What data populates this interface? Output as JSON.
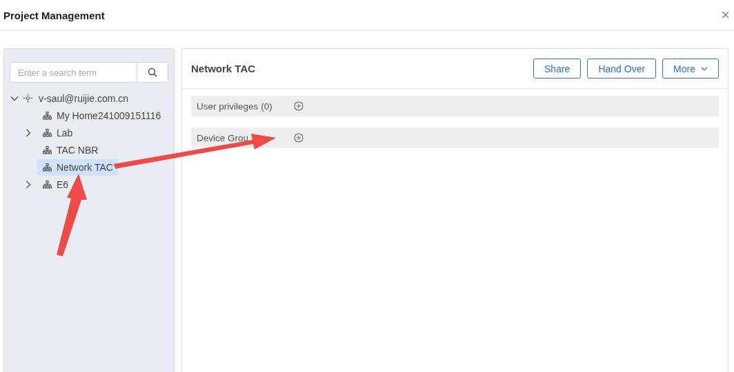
{
  "window": {
    "title": "Project Management",
    "close": "×"
  },
  "search": {
    "placeholder": "Enter a search term"
  },
  "tree": [
    {
      "label": "v-saul@ruijie.com.cn",
      "kind": "account",
      "expanded": true,
      "selected": false,
      "children": [
        {
          "label": "My Home241009151116",
          "kind": "project",
          "selected": false
        },
        {
          "label": "Lab",
          "kind": "project",
          "expanded": false,
          "selected": false
        },
        {
          "label": "TAC NBR",
          "kind": "project",
          "selected": false
        },
        {
          "label": "Network TAC",
          "kind": "project",
          "selected": true
        },
        {
          "label": "E6",
          "kind": "project",
          "expanded": false,
          "selected": false
        }
      ]
    }
  ],
  "detail": {
    "title": "Network TAC",
    "buttons": [
      {
        "label": "Share",
        "kind": "plain"
      },
      {
        "label": "Hand Over",
        "kind": "plain"
      },
      {
        "label": "More",
        "kind": "dropdown"
      }
    ],
    "sections": [
      {
        "label": "User privileges",
        "count": "(0)"
      },
      {
        "label": "Device Grou"
      }
    ]
  }
}
